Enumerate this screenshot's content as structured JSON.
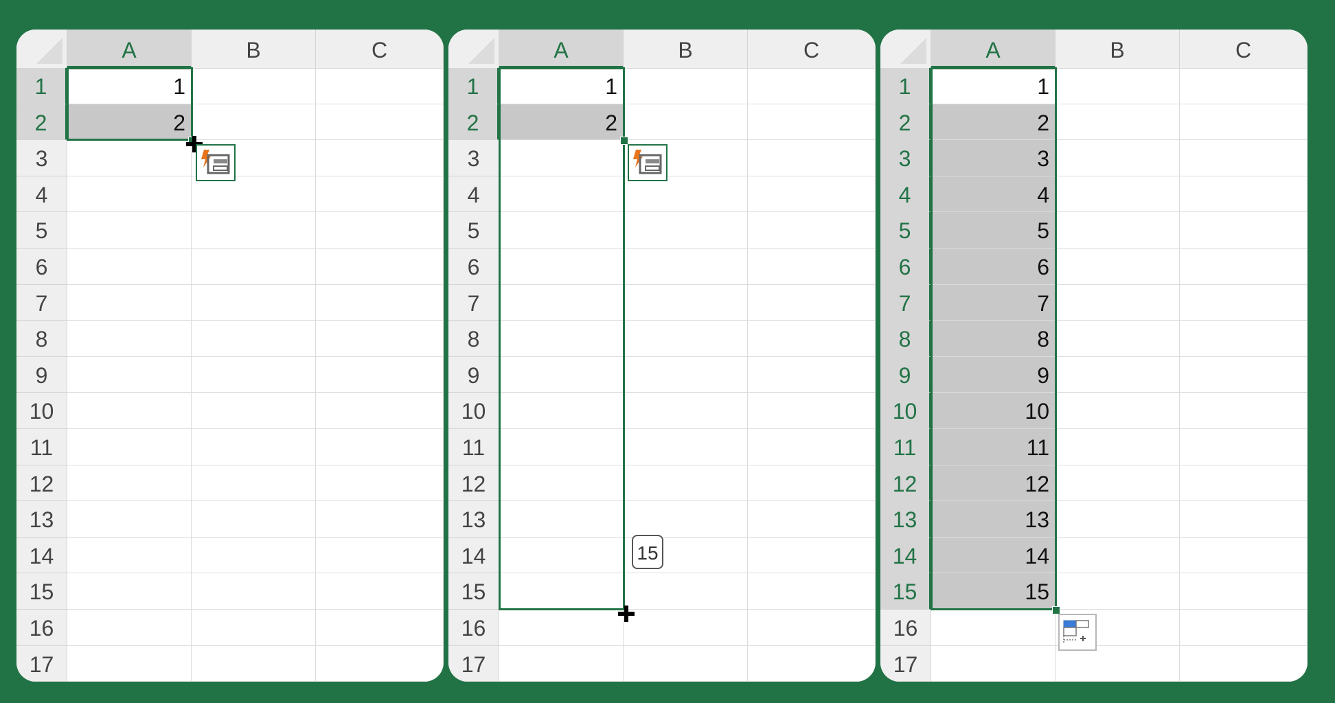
{
  "columns": [
    "A",
    "B",
    "C"
  ],
  "rows": [
    "1",
    "2",
    "3",
    "4",
    "5",
    "6",
    "7",
    "8",
    "9",
    "10",
    "11",
    "12",
    "13",
    "14",
    "15",
    "16",
    "17"
  ],
  "panels": [
    {
      "cells_a": [
        "1",
        "2",
        "",
        "",
        "",
        "",
        "",
        "",
        "",
        "",
        "",
        "",
        "",
        "",
        "",
        "",
        ""
      ],
      "shaded_rows": [
        2
      ],
      "active_rows": [
        1,
        2
      ],
      "selection_rows": [
        1,
        2
      ],
      "icon": "flash-fill-icon",
      "tooltip": ""
    },
    {
      "cells_a": [
        "1",
        "2",
        "",
        "",
        "",
        "",
        "",
        "",
        "",
        "",
        "",
        "",
        "",
        "",
        "",
        "",
        ""
      ],
      "shaded_rows": [
        2
      ],
      "active_rows": [
        1,
        2
      ],
      "selection_rows": [
        1,
        15
      ],
      "icon": "flash-fill-icon",
      "tooltip": "15"
    },
    {
      "cells_a": [
        "1",
        "2",
        "3",
        "4",
        "5",
        "6",
        "7",
        "8",
        "9",
        "10",
        "11",
        "12",
        "13",
        "14",
        "15",
        "",
        ""
      ],
      "shaded_rows": [
        2,
        3,
        4,
        5,
        6,
        7,
        8,
        9,
        10,
        11,
        12,
        13,
        14,
        15
      ],
      "active_rows": [
        1,
        2,
        3,
        4,
        5,
        6,
        7,
        8,
        9,
        10,
        11,
        12,
        13,
        14,
        15
      ],
      "selection_rows": [
        1,
        15
      ],
      "icon": "autofill-options-icon",
      "tooltip": ""
    }
  ],
  "colors": {
    "background": "#217346",
    "accent": "#217346",
    "shaded_cell": "#c8c8c8"
  }
}
